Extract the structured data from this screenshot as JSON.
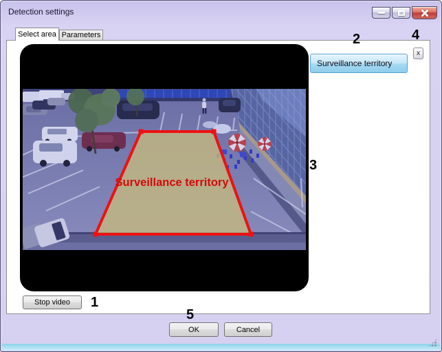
{
  "window": {
    "title": "Detection settings",
    "controls": {
      "minimize_icon": "minimize",
      "maximize_icon": "maximize",
      "close_icon": "close"
    }
  },
  "tabs": [
    {
      "label": "Select area",
      "active": true
    },
    {
      "label": "Parameters",
      "active": false
    }
  ],
  "video": {
    "overlay_label": "Surveillance territory",
    "stop_label": "Stop video"
  },
  "territory": {
    "selected_label": "Surveillance territory",
    "remove_label": "x"
  },
  "footer": {
    "ok": "OK",
    "cancel": "Cancel"
  },
  "annotations": {
    "n1": "1",
    "n2": "2",
    "n3": "3",
    "n4": "4",
    "n5": "5"
  },
  "colors": {
    "dialog_background": "#d6d0f1",
    "titlebar_text": "#15152d",
    "close_button_red": "#c03a3c",
    "territory_button_blue": "#a6d9f2",
    "zone_outline_red": "#ee1111",
    "zone_fill_khaki": "#c6ba7e",
    "zone_label_red": "#d40a0a",
    "bottom_edge_glow": "#9fdff5"
  }
}
